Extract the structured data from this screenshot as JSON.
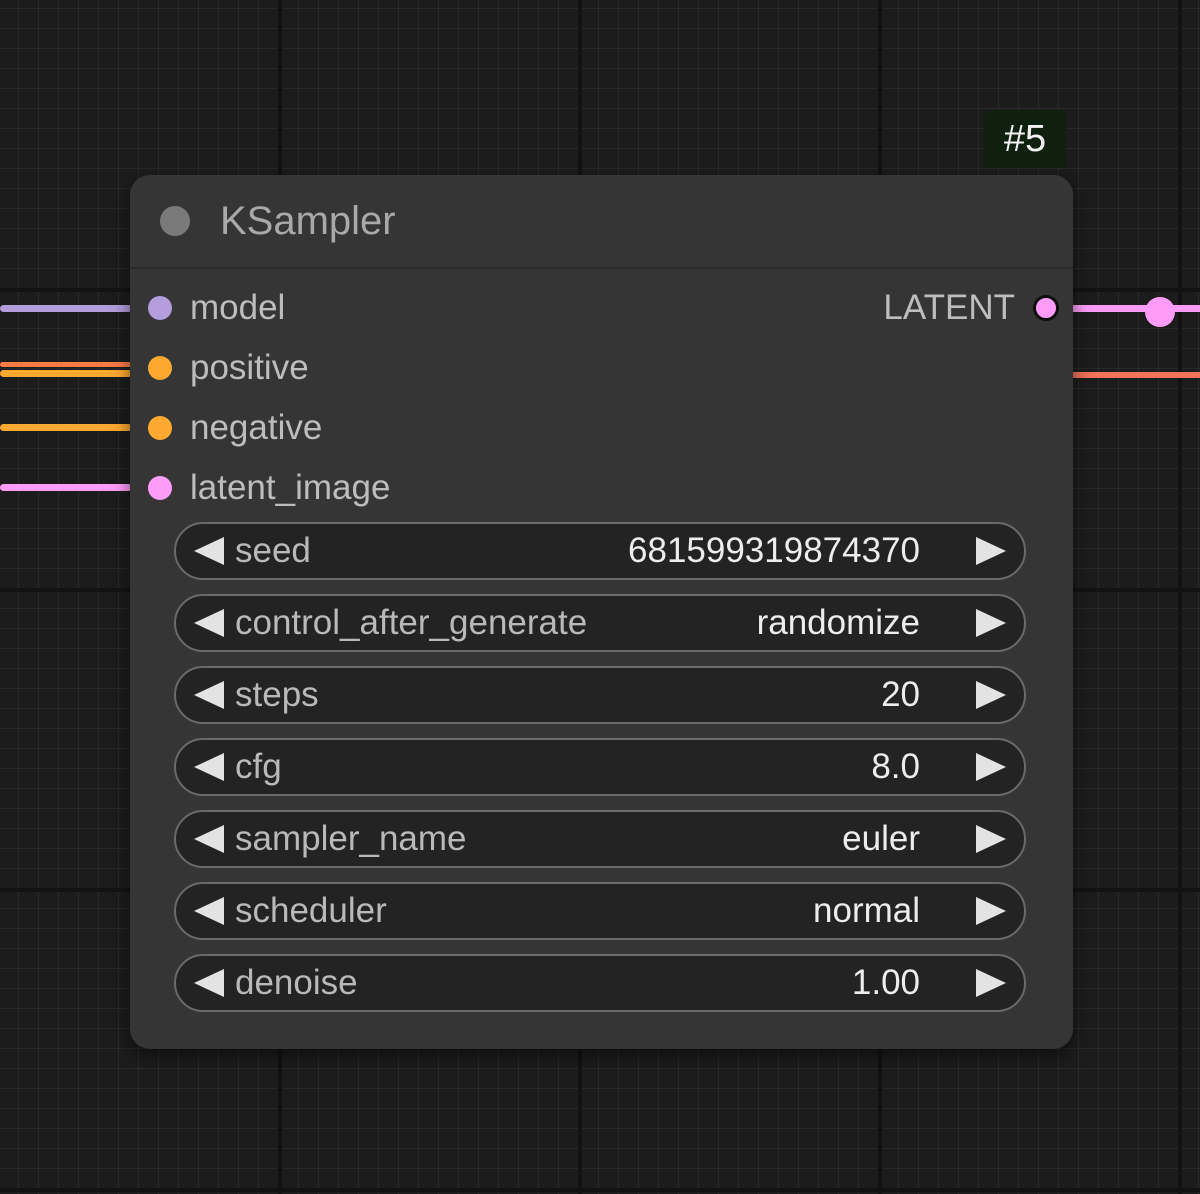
{
  "node": {
    "id_badge": "#5",
    "title": "KSampler"
  },
  "inputs": [
    {
      "label": "model",
      "color": "#b39ddb"
    },
    {
      "label": "positive",
      "color": "#ffa931"
    },
    {
      "label": "negative",
      "color": "#ffa931"
    },
    {
      "label": "latent_image",
      "color": "#ff9cf9"
    }
  ],
  "outputs": [
    {
      "label": "LATENT",
      "color": "#ff9cf9"
    }
  ],
  "widgets": [
    {
      "label": "seed",
      "value": "681599319874370"
    },
    {
      "label": "control_after_generate",
      "value": "randomize"
    },
    {
      "label": "steps",
      "value": "20"
    },
    {
      "label": "cfg",
      "value": "8.0"
    },
    {
      "label": "sampler_name",
      "value": "euler"
    },
    {
      "label": "scheduler",
      "value": "normal"
    },
    {
      "label": "denoise",
      "value": "1.00"
    }
  ],
  "colors": {
    "model_wire": "#b39ddb",
    "conditioning_wire": "#ffa931",
    "conditioning_wire_alt": "#ff7a45",
    "latent_wire": "#ff9cf9",
    "output_wire_secondary": "#f2725a",
    "node_body": "#353535",
    "badge_bg": "#10200f"
  }
}
